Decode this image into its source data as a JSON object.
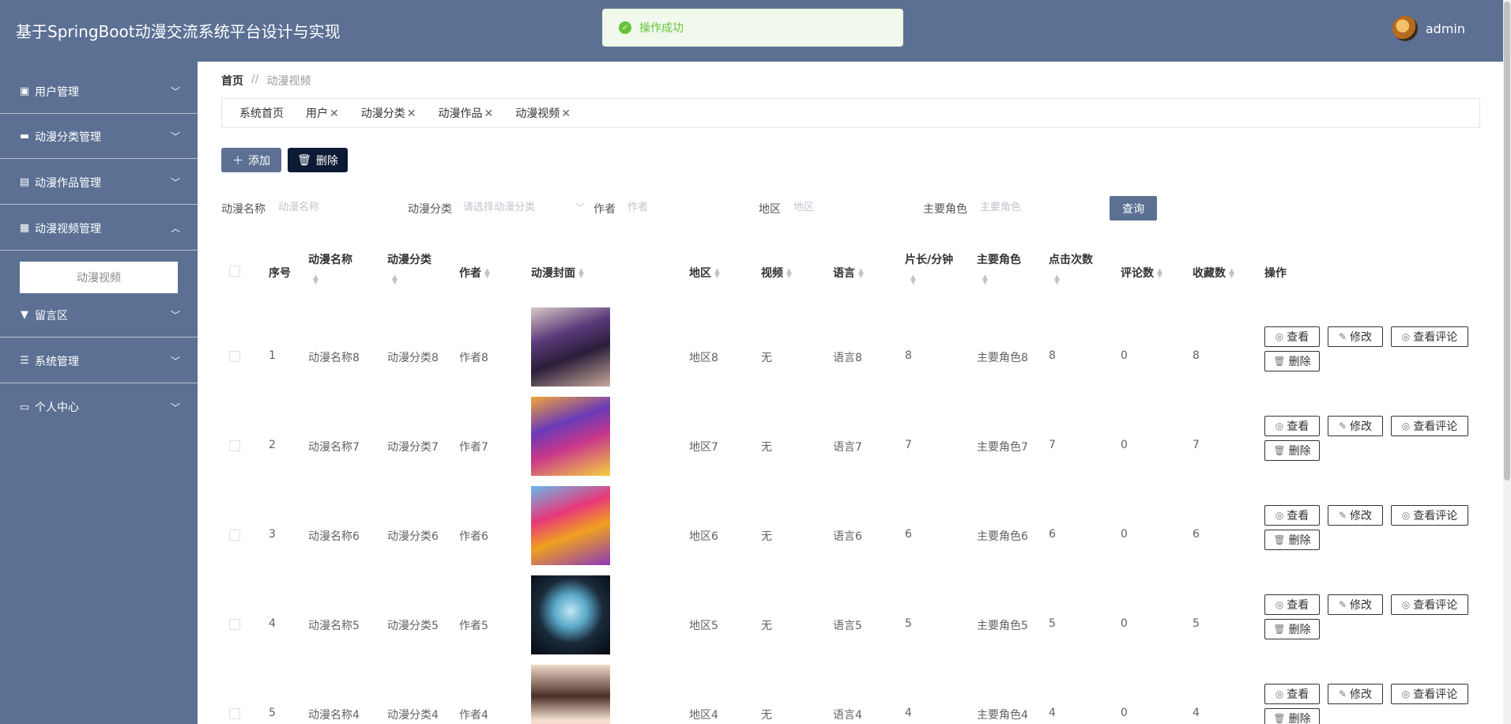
{
  "app": {
    "title": "基于SpringBoot动漫交流系统平台设计与实现",
    "user_name": "admin"
  },
  "toast": {
    "message": "操作成功"
  },
  "sidebar": {
    "items": [
      {
        "label": "用户管理",
        "icon": "user-icon"
      },
      {
        "label": "动漫分类管理",
        "icon": "briefcase-icon"
      },
      {
        "label": "动漫作品管理",
        "icon": "clipboard-icon"
      },
      {
        "label": "动漫视频管理",
        "icon": "grid-icon"
      },
      {
        "label": "留言区",
        "icon": "message-icon"
      },
      {
        "label": "系统管理",
        "icon": "list-icon"
      },
      {
        "label": "个人中心",
        "icon": "card-icon"
      }
    ],
    "active_sub": "动漫视频"
  },
  "breadcrumb": {
    "home": "首页",
    "sep": "//",
    "current": "动漫视频"
  },
  "tabs": [
    {
      "label": "系统首页",
      "closable": false
    },
    {
      "label": "用户",
      "closable": true
    },
    {
      "label": "动漫分类",
      "closable": true
    },
    {
      "label": "动漫作品",
      "closable": true
    },
    {
      "label": "动漫视频",
      "closable": true
    }
  ],
  "toolbar": {
    "add_label": "添加",
    "delete_label": "删除"
  },
  "search": {
    "name_label": "动漫名称",
    "name_placeholder": "动漫名称",
    "category_label": "动漫分类",
    "category_placeholder": "请选择动漫分类",
    "author_label": "作者",
    "author_placeholder": "作者",
    "region_label": "地区",
    "region_placeholder": "地区",
    "role_label": "主要角色",
    "role_placeholder": "主要角色",
    "query_label": "查询"
  },
  "table": {
    "headers": {
      "index": "序号",
      "name": "动漫名称",
      "category": "动漫分类",
      "author": "作者",
      "cover": "动漫封面",
      "region": "地区",
      "video": "视频",
      "language": "语言",
      "length": "片长/分钟",
      "role": "主要角色",
      "clicks": "点击次数",
      "comments": "评论数",
      "favorites": "收藏数",
      "ops": "操作"
    },
    "op_labels": {
      "view": "查看",
      "edit": "修改",
      "view_comments": "查看评论",
      "delete": "删除"
    },
    "rows": [
      {
        "index": "1",
        "name": "动漫名称8",
        "category": "动漫分类8",
        "author": "作者8",
        "region": "地区8",
        "video": "无",
        "language": "语言8",
        "length": "8",
        "role": "主要角色8",
        "clicks": "8",
        "comments": "0",
        "favorites": "8"
      },
      {
        "index": "2",
        "name": "动漫名称7",
        "category": "动漫分类7",
        "author": "作者7",
        "region": "地区7",
        "video": "无",
        "language": "语言7",
        "length": "7",
        "role": "主要角色7",
        "clicks": "7",
        "comments": "0",
        "favorites": "7"
      },
      {
        "index": "3",
        "name": "动漫名称6",
        "category": "动漫分类6",
        "author": "作者6",
        "region": "地区6",
        "video": "无",
        "language": "语言6",
        "length": "6",
        "role": "主要角色6",
        "clicks": "6",
        "comments": "0",
        "favorites": "6"
      },
      {
        "index": "4",
        "name": "动漫名称5",
        "category": "动漫分类5",
        "author": "作者5",
        "region": "地区5",
        "video": "无",
        "language": "语言5",
        "length": "5",
        "role": "主要角色5",
        "clicks": "5",
        "comments": "0",
        "favorites": "5"
      },
      {
        "index": "5",
        "name": "动漫名称4",
        "category": "动漫分类4",
        "author": "作者4",
        "region": "地区4",
        "video": "无",
        "language": "语言4",
        "length": "4",
        "role": "主要角色4",
        "clicks": "4",
        "comments": "0",
        "favorites": "4"
      }
    ]
  }
}
